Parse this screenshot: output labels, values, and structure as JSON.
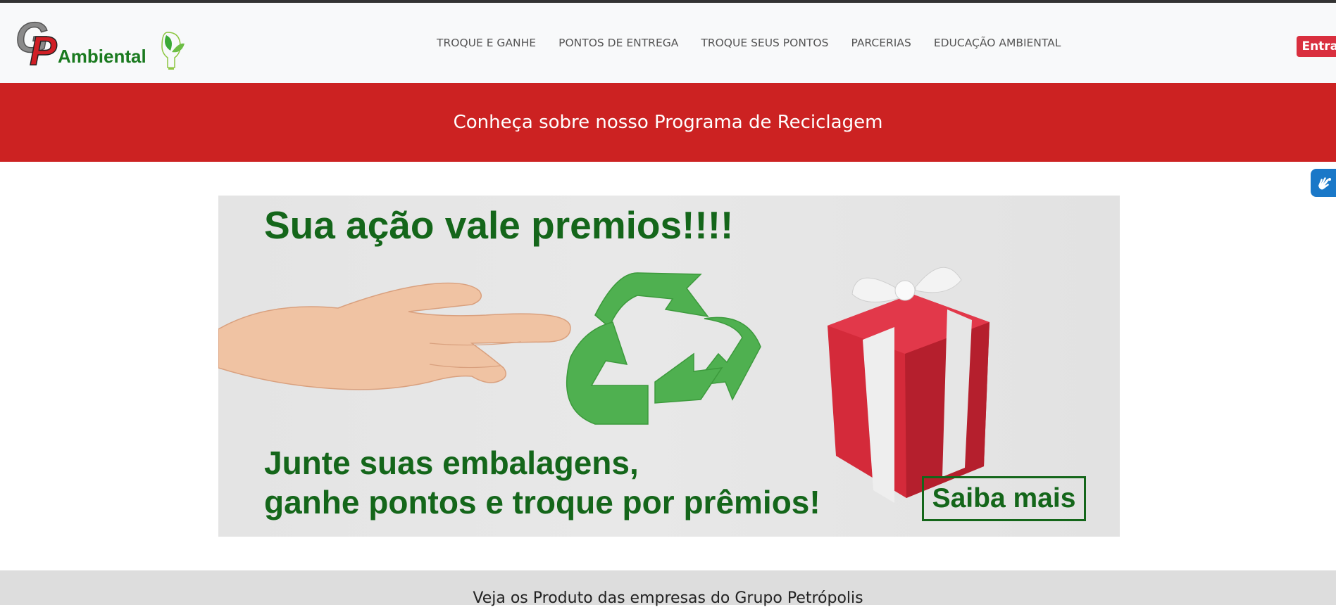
{
  "logo": {
    "initials_g": "G",
    "initials_p": "P",
    "name": "Ambiental"
  },
  "nav": {
    "links": [
      "TROQUE E GANHE",
      "PONTOS DE ENTREGA",
      "TROQUE SEUS PONTOS",
      "PARCERIAS",
      "EDUCAÇÃO AMBIENTAL"
    ],
    "login_label": "Entrar"
  },
  "banner": {
    "title": "Conheça sobre nosso Programa de Reciclagem"
  },
  "hero": {
    "title": "Sua ação vale premios!!!!",
    "subtitle_line1": "Junte suas embalagens,",
    "subtitle_line2": "ganhe pontos e troque por prêmios!",
    "cta_label": "Saiba mais"
  },
  "section": {
    "title": "Veja os Produto das empresas do Grupo Petrópolis"
  },
  "icons": {
    "accessibility": "sign-language-icon",
    "recycle": "recycle-icon",
    "gift": "gift-icon",
    "hand": "hand-icon"
  },
  "colors": {
    "brand_red": "#cc2222",
    "brand_green": "#14661a",
    "button_red": "#d92f3e",
    "a11y_blue": "#1a78c8"
  }
}
